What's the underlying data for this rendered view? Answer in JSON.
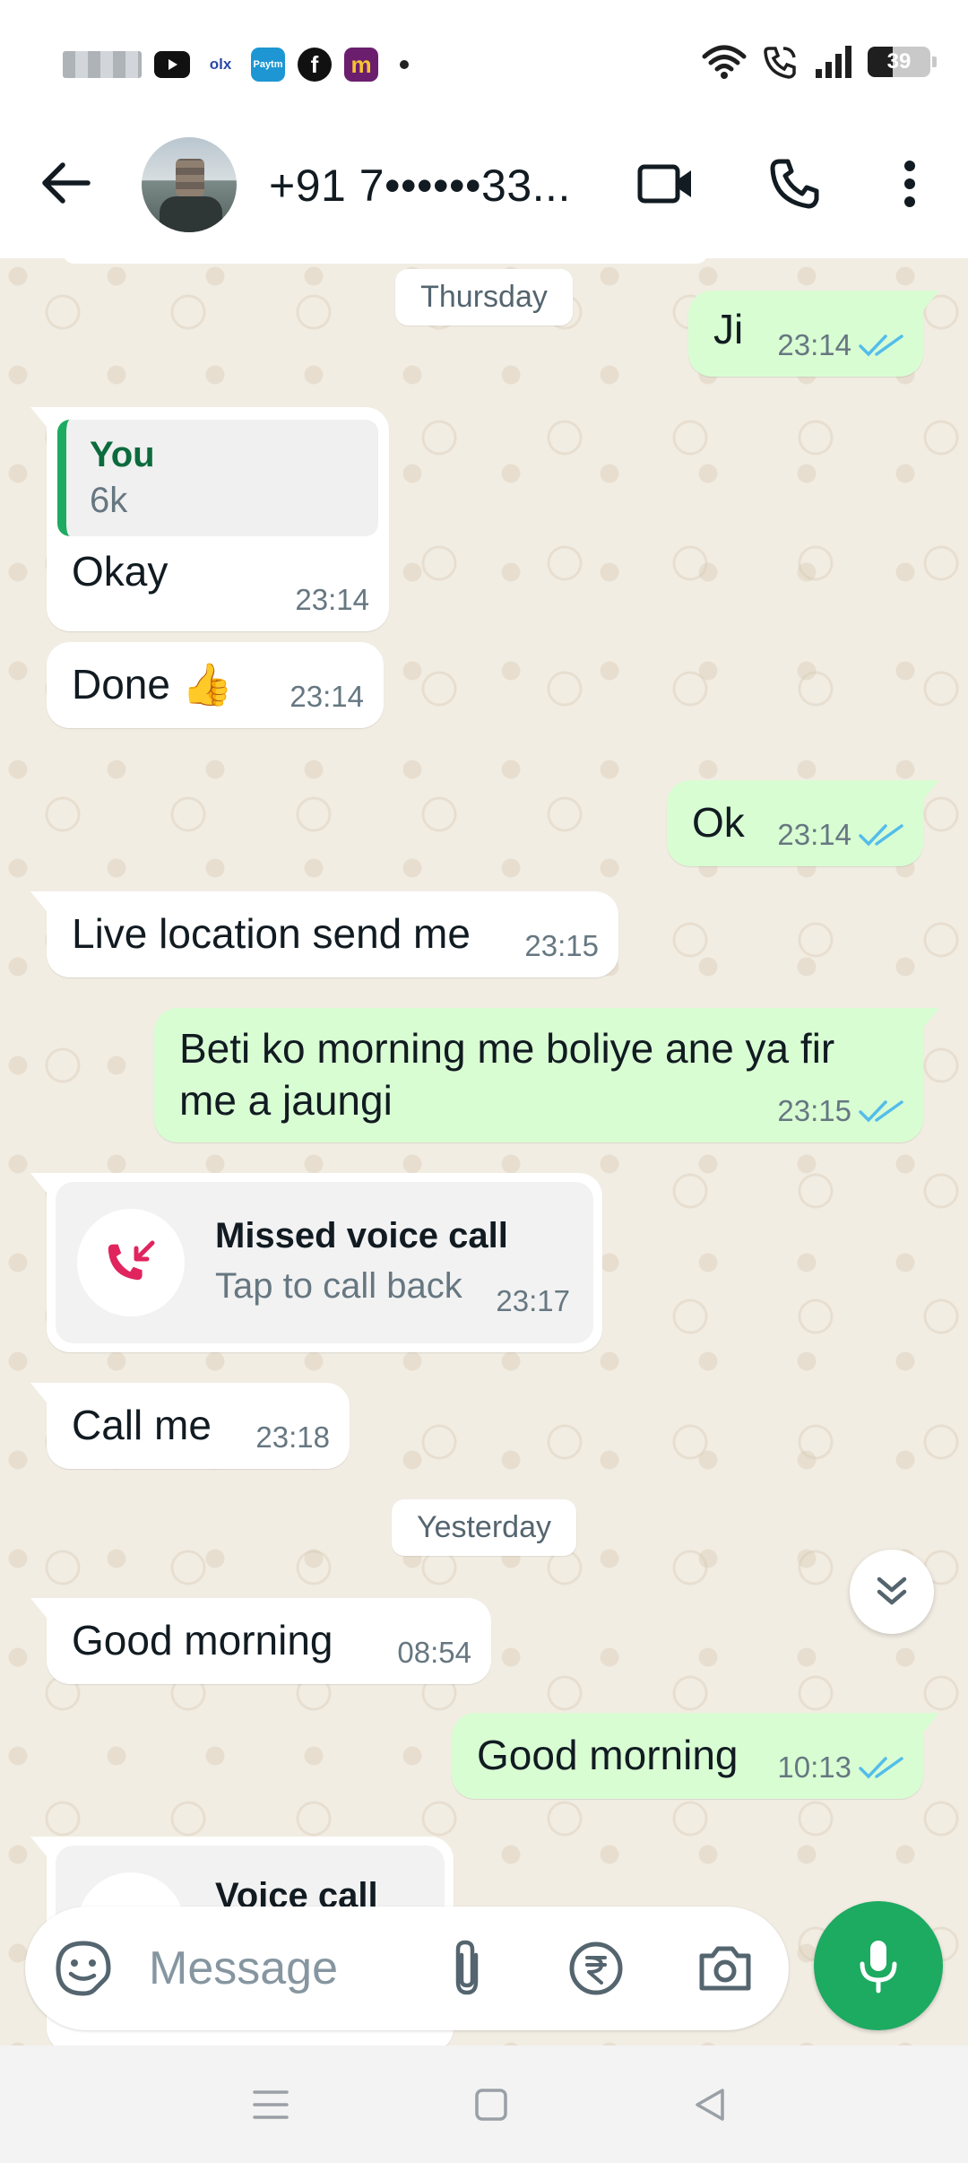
{
  "header": {
    "contact_name": "+91 7••••••33..."
  },
  "status_bar": {
    "battery": "39",
    "app_icons": [
      "youtube-icon",
      "olx-icon",
      "paytm-icon",
      "facebook-icon",
      "meesho-icon"
    ]
  },
  "colors": {
    "incoming_bubble": "#ffffff",
    "outgoing_bubble": "#d9fdd3",
    "chat_background": "#f2ede3",
    "accent_green": "#1daa61",
    "read_ticks": "#53bdeb",
    "missed_call_red": "#e0245e"
  },
  "chat": {
    "date_thursday": "Thursday",
    "date_yesterday": "Yesterday",
    "messages": [
      {
        "text": "Ji",
        "time": "23:14",
        "status": "read"
      },
      {
        "quote_name": "You",
        "quote_text": "6k",
        "text": "Okay",
        "time": "23:14"
      },
      {
        "text": "Done 👍",
        "time": "23:14"
      },
      {
        "text": "Ok",
        "time": "23:14",
        "status": "read"
      },
      {
        "text": "Live location send me",
        "time": "23:15"
      },
      {
        "text": "Beti ko morning me boliye ane ya fir me a jaungi",
        "time": "23:15",
        "status": "read"
      },
      {
        "call_title": "Missed voice call",
        "call_sub": "Tap to call back",
        "time": "23:17"
      },
      {
        "text": "Call me",
        "time": "23:18"
      },
      {
        "text": "Good morning",
        "time": "08:54"
      },
      {
        "text": "Good morning",
        "time": "10:13",
        "status": "read"
      },
      {
        "call_title": "Voice call"
      }
    ]
  },
  "input": {
    "placeholder": "Message"
  }
}
